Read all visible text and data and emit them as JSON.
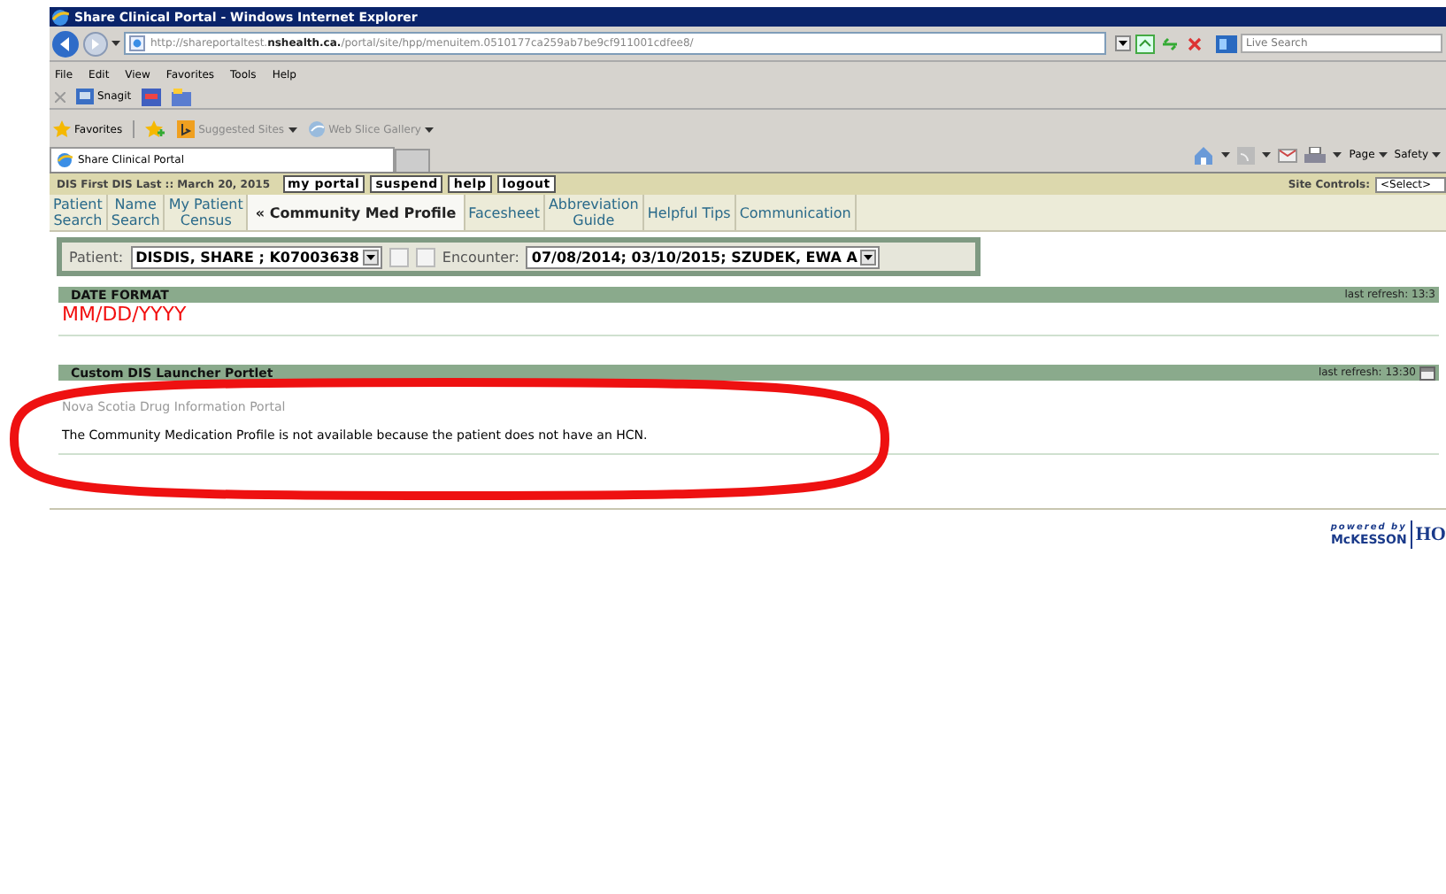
{
  "window": {
    "title": "Share Clinical Portal - Windows Internet Explorer"
  },
  "address_bar": {
    "url": "http://shareportaltest.nshealth.ca./portal/site/hpp/menuitem.0510177ca259ab7be9cf911001cdfee8/",
    "search_placeholder": "Live Search"
  },
  "menu": [
    "File",
    "Edit",
    "View",
    "Favorites",
    "Tools",
    "Help"
  ],
  "toolbar": [
    "Snagit"
  ],
  "favorites_bar": {
    "label": "Favorites",
    "items": [
      "Suggested Sites",
      "Web Slice Gallery"
    ]
  },
  "browser_tabs": [
    {
      "label": "Share Clinical Portal",
      "selected": true
    }
  ],
  "command_bar": [
    "Page",
    "Safety"
  ],
  "portal": {
    "user_line": "DIS First DIS Last :: March 20, 2015",
    "buttons": [
      "my portal",
      "suspend",
      "help",
      "logout"
    ],
    "site_controls_label": "Site Controls:",
    "site_controls_value": "<Select>"
  },
  "tabs": [
    {
      "label": "Patient\nSearch",
      "selected": false
    },
    {
      "label": "Name\nSearch",
      "selected": false
    },
    {
      "label": "My Patient\nCensus",
      "selected": false
    },
    {
      "label": "« Community Med Profile",
      "selected": true
    },
    {
      "label": "Facesheet",
      "selected": false
    },
    {
      "label": "Abbreviation\nGuide",
      "selected": false
    },
    {
      "label": "Helpful Tips",
      "selected": false
    },
    {
      "label": "Communication",
      "selected": false
    }
  ],
  "patient_bar": {
    "patient_label": "Patient:",
    "patient": "DISDIS, SHARE ; K07003638",
    "encounter_label": "Encounter:",
    "encounter": "07/08/2014; 03/10/2015; SZUDEK, EWA A"
  },
  "portlets": [
    {
      "title": "DATE FORMAT",
      "refresh": "last refresh: 13:3",
      "kind": "date",
      "value": "MM/DD/YYYY"
    },
    {
      "title": "Custom DIS Launcher Portlet",
      "refresh": "last refresh: 13:30",
      "kind": "message",
      "link": "Nova Scotia Drug Information Portal",
      "message": "The Community Medication Profile is not available because the patient does not have an HCN."
    }
  ],
  "footer": {
    "powered_by": "powered by",
    "brand": "McKESSON",
    "brand_2": "HO"
  }
}
